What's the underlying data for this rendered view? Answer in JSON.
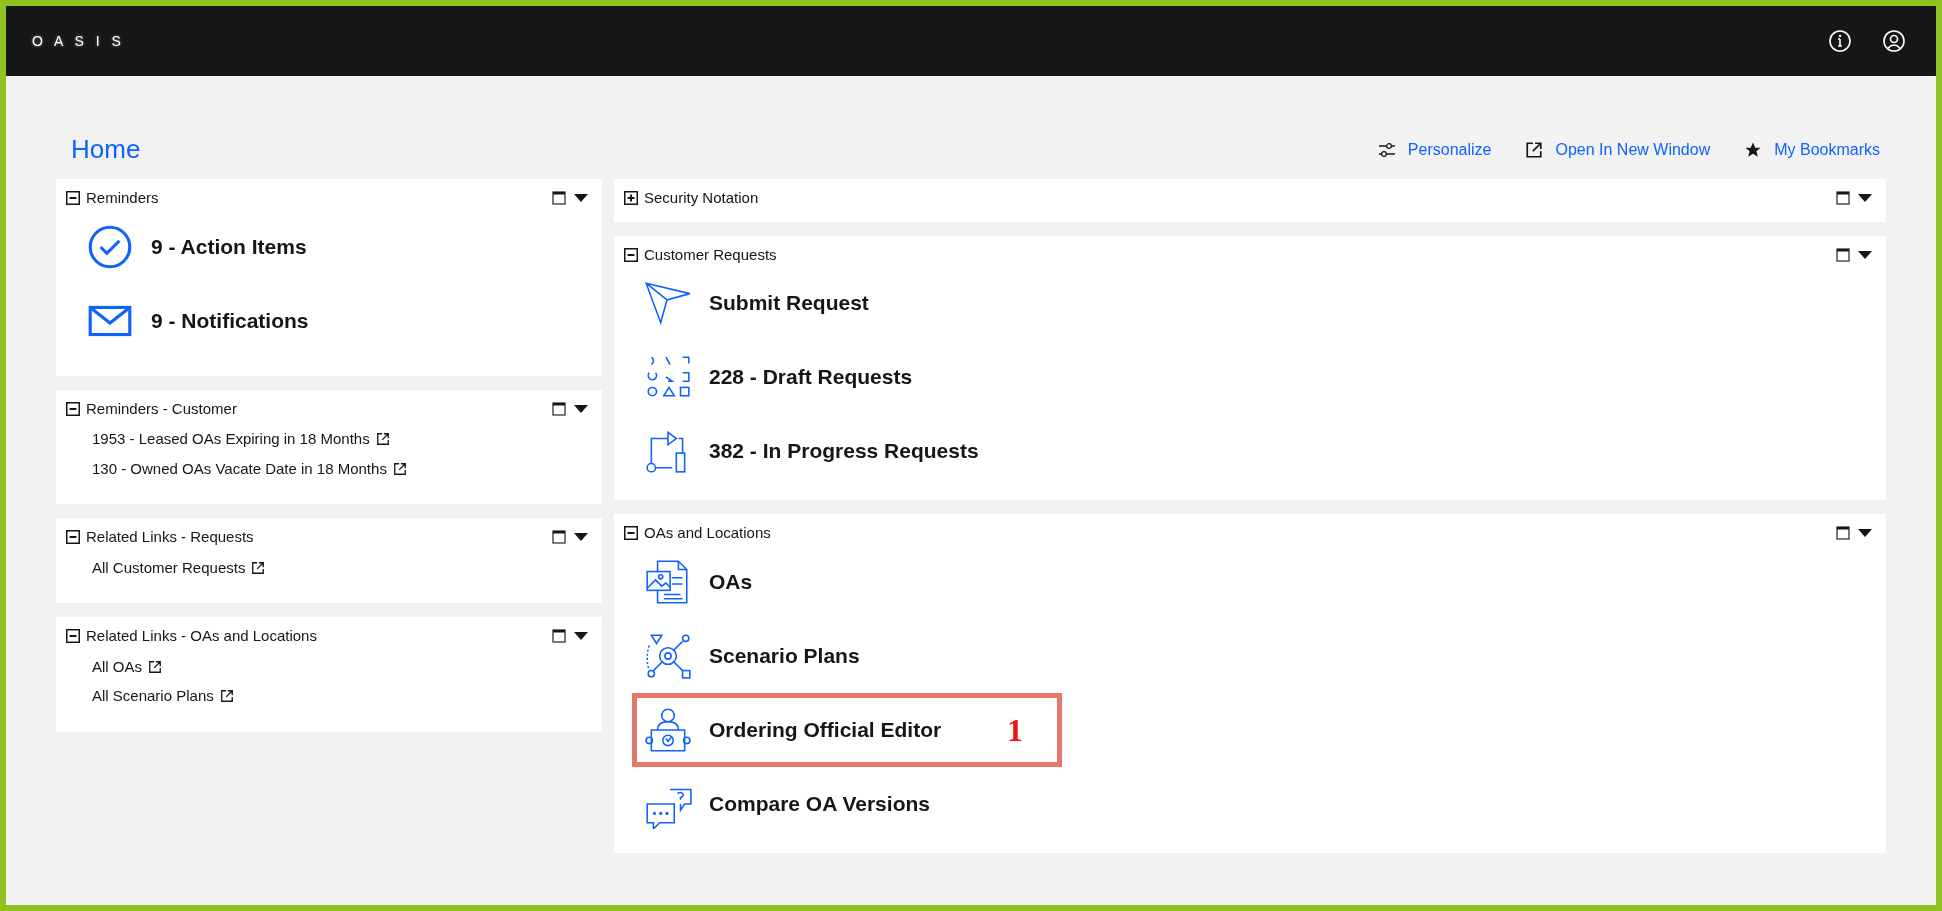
{
  "app": {
    "logo": "O A S I S"
  },
  "page": {
    "title": "Home",
    "actions": [
      {
        "label": "Personalize"
      },
      {
        "label": "Open In New Window"
      },
      {
        "label": "My Bookmarks"
      }
    ]
  },
  "left_panels": [
    {
      "title": "Reminders",
      "expanded": true,
      "kind": "large",
      "items": [
        {
          "label": "9 - Action Items",
          "highlighted": false
        },
        {
          "label": "9 - Notifications",
          "highlighted": false
        }
      ]
    },
    {
      "title": "Reminders - Customer",
      "expanded": true,
      "kind": "links",
      "items": [
        {
          "label": "1953 - Leased OAs Expiring in 18 Months"
        },
        {
          "label": "130 - Owned OAs Vacate Date in 18 Months"
        }
      ]
    },
    {
      "title": "Related Links - Requests",
      "expanded": true,
      "kind": "links",
      "items": [
        {
          "label": "All Customer Requests"
        }
      ]
    },
    {
      "title": "Related Links - OAs and Locations",
      "expanded": true,
      "kind": "links",
      "items": [
        {
          "label": "All OAs"
        },
        {
          "label": "All Scenario Plans"
        }
      ]
    }
  ],
  "right_panels": [
    {
      "title": "Security Notation",
      "expanded": false
    },
    {
      "title": "Customer Requests",
      "expanded": true,
      "kind": "large",
      "items": [
        {
          "label": "Submit Request",
          "highlighted": false
        },
        {
          "label": "228 - Draft Requests",
          "highlighted": false
        },
        {
          "label": "382 - In Progress Requests",
          "highlighted": false
        }
      ]
    },
    {
      "title": "OAs and Locations",
      "expanded": true,
      "kind": "large",
      "items": [
        {
          "label": "OAs",
          "highlighted": false
        },
        {
          "label": "Scenario Plans",
          "highlighted": false
        },
        {
          "label": "Ordering Official Editor",
          "highlighted": true,
          "annotation": "1"
        },
        {
          "label": "Compare OA Versions",
          "highlighted": false
        }
      ]
    }
  ]
}
